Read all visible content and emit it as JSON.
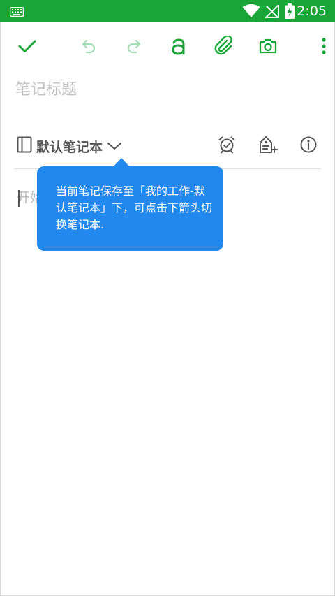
{
  "status_bar": {
    "time": "2:05",
    "icons": [
      "keyboard-icon",
      "wifi-icon",
      "no-signal-icon",
      "battery-charging-icon"
    ]
  },
  "toolbar": {
    "icons": [
      "check-icon",
      "undo-icon",
      "redo-icon",
      "text-format-icon",
      "attachment-icon",
      "camera-icon",
      "more-vert-icon"
    ],
    "accent_color": "#19a638",
    "disabled_color": "#a6dcb6"
  },
  "note": {
    "title_placeholder": "笔记标题",
    "body_placeholder": "开始"
  },
  "notebook": {
    "name": "默认笔记本",
    "icons": [
      "notebook-icon",
      "chevron-down-icon",
      "alarm-icon",
      "tag-icon",
      "info-icon"
    ]
  },
  "tooltip": {
    "text": "当前笔记保存至「我的工作-默认笔记本」下，可点击下箭头切换笔记本.",
    "color": "#2288ee"
  }
}
